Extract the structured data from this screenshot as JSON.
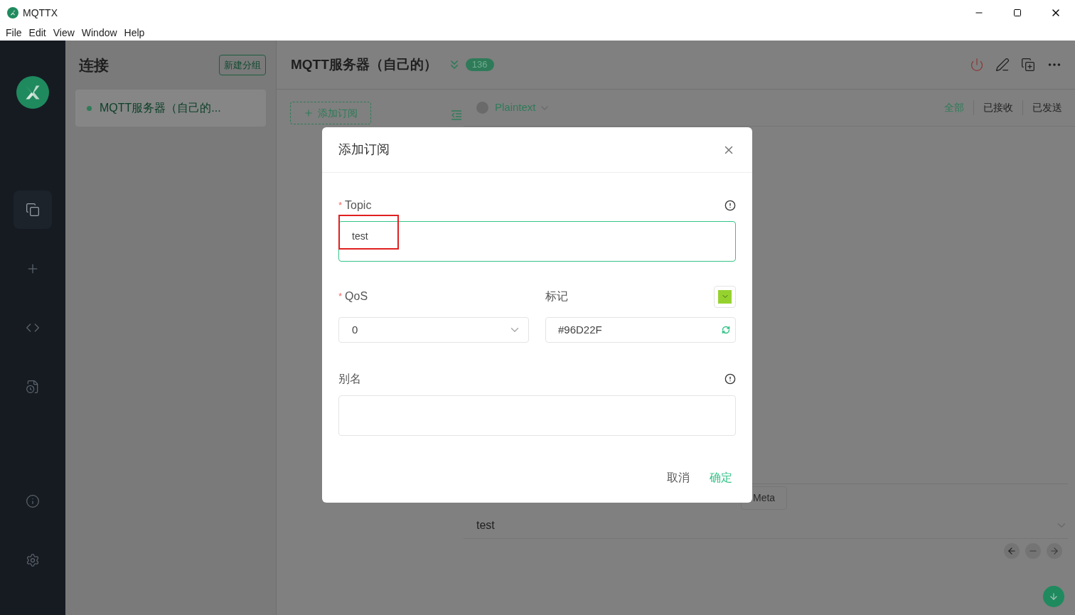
{
  "window": {
    "title": "MQTTX"
  },
  "menu": [
    "File",
    "Edit",
    "View",
    "Window",
    "Help"
  ],
  "nav": [
    {
      "kind": "connections",
      "selected": true
    },
    {
      "kind": "new",
      "selected": false
    },
    {
      "kind": "script",
      "selected": false
    },
    {
      "kind": "log",
      "selected": false
    },
    {
      "kind": "about",
      "selected": false
    },
    {
      "kind": "settings",
      "selected": false
    }
  ],
  "connections": {
    "title": "连接",
    "new_group_button": "新建分组",
    "items": [
      {
        "name": "MQTT服务器（自己的...",
        "selected": true,
        "online": true
      }
    ]
  },
  "header": {
    "title": "MQTT服务器（自己的）",
    "badge": "136"
  },
  "toolbar": {
    "add_subscription": "添加订阅",
    "payload_format": "Plaintext",
    "filters": [
      {
        "label": "全部",
        "selected": true
      },
      {
        "label": "已接收",
        "selected": false
      },
      {
        "label": "已发送",
        "selected": false
      }
    ]
  },
  "composer": {
    "meta_button": "Meta",
    "payload": "test"
  },
  "dialog": {
    "title": "添加订阅",
    "required_mark": "*",
    "topic": {
      "label": "Topic",
      "required": true,
      "value": "test",
      "highlighted": true
    },
    "qos": {
      "label": "QoS",
      "required": true,
      "value": "0"
    },
    "mark": {
      "label": "标记",
      "value": "#96D22F",
      "color": "#96d22f"
    },
    "alias": {
      "label": "别名"
    },
    "cancel": "取消",
    "confirm": "确定"
  }
}
